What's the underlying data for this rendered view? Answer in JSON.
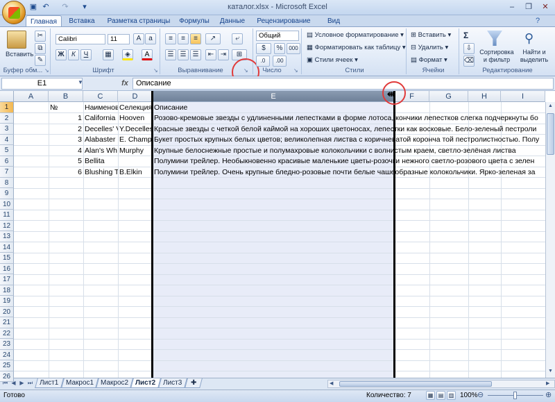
{
  "title": "каталог.xlsx - Microsoft Excel",
  "qat": {
    "undo": "↶",
    "redo": "↷"
  },
  "tabs": [
    "Главная",
    "Вставка",
    "Разметка страницы",
    "Формулы",
    "Данные",
    "Рецензирование",
    "Вид"
  ],
  "ribbon": {
    "clipboard": {
      "paste": "Вставить",
      "label": "Буфер обм..."
    },
    "font": {
      "name": "Calibri",
      "size": "11",
      "label": "Шрифт",
      "bold": "Ж",
      "italic": "К",
      "underline": "Ч"
    },
    "alignment": {
      "label": "Выравнивание"
    },
    "number": {
      "format": "Общий",
      "label": "Число",
      "percent": "%",
      "thousands": "000"
    },
    "styles": {
      "conditional": "Условное форматирование",
      "table": "Форматировать как таблицу",
      "cell": "Стили ячеек",
      "label": "Стили"
    },
    "cells": {
      "insert": "Вставить",
      "delete": "Удалить",
      "format": "Формат",
      "label": "Ячейки"
    },
    "editing": {
      "sort": "Сортировка и фильтр",
      "find": "Найти и выделить",
      "label": "Редактирование",
      "sigma": "Σ"
    }
  },
  "formula_bar": {
    "name_box": "E1",
    "fx": "fx",
    "content": "Описание"
  },
  "columns": [
    "A",
    "B",
    "C",
    "D",
    "E",
    "F",
    "G",
    "H",
    "I"
  ],
  "rows": [
    "1",
    "2",
    "3",
    "4",
    "5",
    "6",
    "7",
    "8",
    "9",
    "10",
    "11",
    "12",
    "13",
    "14",
    "15",
    "16",
    "17",
    "18",
    "19",
    "20",
    "21",
    "22",
    "23",
    "24",
    "25",
    "26"
  ],
  "cells": {
    "b1": "№",
    "c1": "Наименов",
    "d1": "Селекция",
    "e1": "Описание",
    "b2": "1",
    "c2": "California",
    "d2": "Hooven",
    "e2": "Розово-кремовые звезды с удлиненными лепестками в форме лотоса, кончики лепестков слегка подчеркнуты бо",
    "b3": "2",
    "c3": "Decelles' V",
    "d3": "Y.Decelles",
    "e3": "Красные звезды с четкой белой каймой на хороших цветоносах, лепестки как восковые. Бело-зеленый пестроли",
    "b4": "3",
    "c4": "Alabaster",
    "d4": "E. Champi",
    "e4": "Букет простых крупных белых цветов; великолепная листва с коричневатой коронча той пестролистностью. Полу",
    "b5": "4",
    "c5": "Alan's Wh",
    "d5": "Murphy",
    "e5": "Крупные белоснежные простые и полумахровые колокольчики с волнистым краем, светло-зелёная листва",
    "b6": "5",
    "c6": "Bellita",
    "d6": "",
    "e6": "Полумини трейлер. Необыкновенно красивые маленькие цветы-розочки нежного светло-розового цвета с зелен",
    "b7": "6",
    "c7": "Blushing T",
    "d7": "B.Elkin",
    "e7": "Полумини трейлер. Очень крупные бледно-розовые почти белые чашеобразные колокольчики. Ярко-зеленая за"
  },
  "sheets": [
    "Лист1",
    "Макрос1",
    "Макрос2",
    "Лист2",
    "Лист3"
  ],
  "active_sheet": "Лист2",
  "status": {
    "ready": "Готово",
    "count": "Количество: 7",
    "zoom": "100%"
  }
}
